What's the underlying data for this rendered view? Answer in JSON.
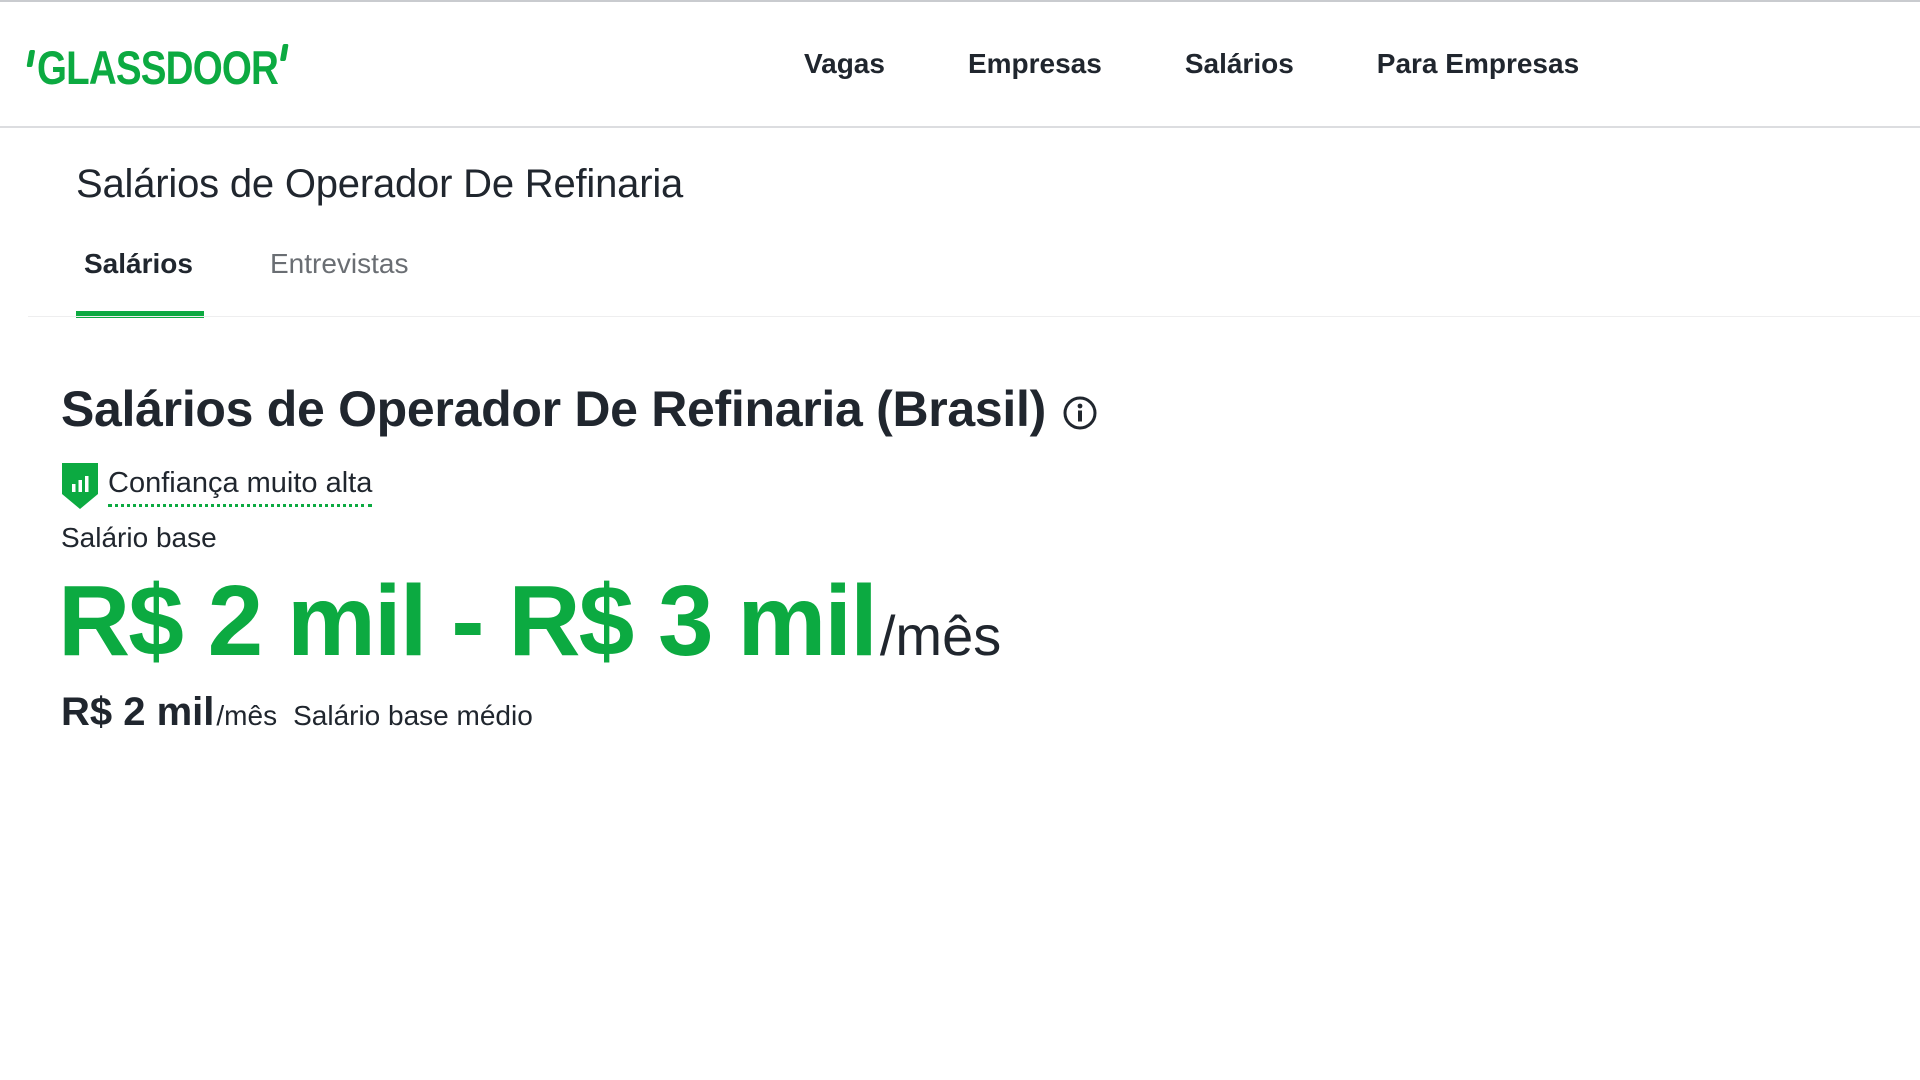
{
  "brand": {
    "logo_text": "GLASSDOOR",
    "color": "#0caa41"
  },
  "nav": {
    "items": [
      {
        "label": "Vagas"
      },
      {
        "label": "Empresas"
      },
      {
        "label": "Salários"
      },
      {
        "label": "Para Empresas"
      }
    ]
  },
  "page": {
    "occupation_title": "Salários de Operador De Refinaria",
    "tabs": [
      {
        "label": "Salários",
        "active": true
      },
      {
        "label": "Entrevistas",
        "active": false
      }
    ]
  },
  "salary": {
    "heading": "Salários de Operador De Refinaria (Brasil)",
    "info_icon": "info-icon",
    "confidence": {
      "icon": "shield-bar-chart-icon",
      "label": "Confiança muito alta"
    },
    "base_label": "Salário base",
    "range_text": "R$ 2 mil - R$ 3 mil",
    "range_unit": "/mês",
    "median_amount": "R$ 2 mil",
    "median_unit": "/mês",
    "median_label": "Salário base médio"
  },
  "colors": {
    "accent": "#0caa41",
    "text": "#20262e",
    "muted": "#6a6e73"
  }
}
